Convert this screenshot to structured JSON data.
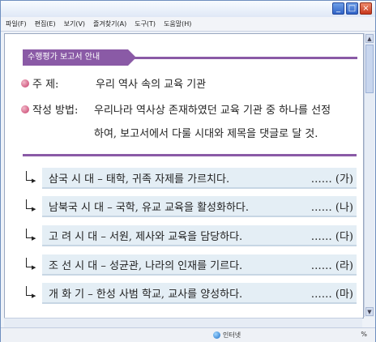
{
  "window": {
    "controls": [
      "_",
      "□",
      "×"
    ]
  },
  "menu": [
    "파일(F)",
    "편집(E)",
    "보기(V)",
    "즐겨찾기(A)",
    "도구(T)",
    "도움말(H)"
  ],
  "section_title": "수행평가 보고서 안내",
  "subject": {
    "label": "주      제:",
    "text": "우리 역사 속의 교육 기관"
  },
  "method": {
    "label": "작성 방법:",
    "line1": "우리나라 역사상 존재하였던 교육 기관 중 하나를 선정",
    "line2": "하여, 보고서에서 다룰 시대와 제목을 댓글로 달 것."
  },
  "rows": [
    {
      "text": "삼국  시 대 – 태학, 귀족 자제를 가르치다.",
      "tag": "…… (가)"
    },
    {
      "text": "남북국 시 대 – 국학, 유교 교육을 활성화하다.",
      "tag": "…… (나)"
    },
    {
      "text": "고 려  시 대 – 서원, 제사와 교육을 담당하다.",
      "tag": "…… (다)"
    },
    {
      "text": "조 선  시 대 – 성균관, 나라의 인재를 기르다.",
      "tag": "…… (라)"
    },
    {
      "text": "개   화   기 – 한성 사범 학교, 교사를 양성하다.",
      "tag": "…… (마)"
    }
  ],
  "status": {
    "zone": "인터넷",
    "zoom": "%"
  }
}
